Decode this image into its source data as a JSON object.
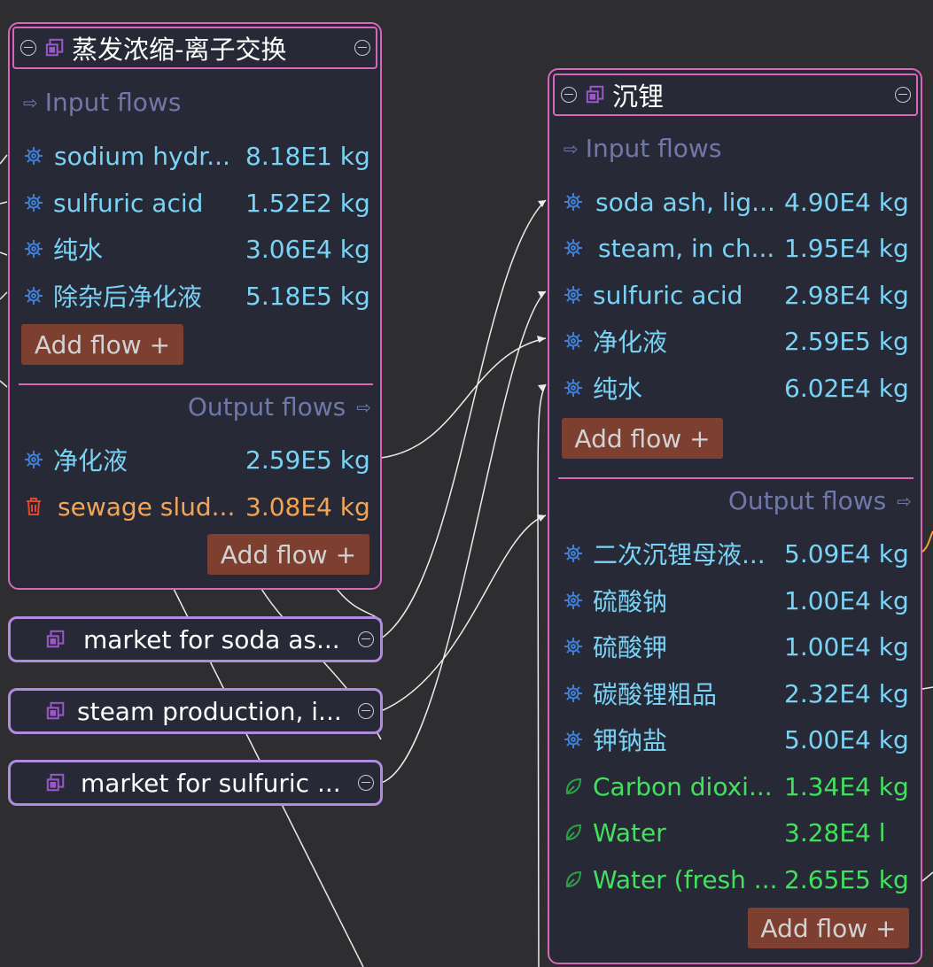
{
  "graph": {
    "colors": {
      "node_border": "#d667b9",
      "provider_border": "#b08be0",
      "technosphere_flow": "#7ad3f5",
      "waste_flow": "#f2a457",
      "elementary_flow": "#43e05f",
      "add_flow_bg": "#7d3f2f",
      "section_label": "#6f78a9"
    },
    "node1": {
      "title": "蒸发浓缩-离子交换",
      "input_label": "Input flows",
      "inputs": [
        {
          "name": "sodium hydr...",
          "amount": "8.18E1 kg",
          "icon": "gear-icon"
        },
        {
          "name": "sulfuric acid",
          "amount": "1.52E2 kg",
          "icon": "gear-icon"
        },
        {
          "name": "纯水",
          "amount": "3.06E4 kg",
          "icon": "gear-icon"
        },
        {
          "name": "除杂后净化液",
          "amount": "5.18E5 kg",
          "icon": "gear-icon"
        }
      ],
      "add_input_label": "Add flow +",
      "output_label": "Output flows",
      "outputs": [
        {
          "name": "净化液",
          "amount": "2.59E5 kg",
          "icon": "gear-icon"
        },
        {
          "name": "sewage slud...",
          "amount": "3.08E4 kg",
          "icon": "trash-icon"
        }
      ],
      "add_output_label": "Add flow +"
    },
    "node2": {
      "title": "沉锂",
      "input_label": "Input flows",
      "inputs": [
        {
          "name": "soda ash, lig...",
          "amount": "4.90E4 kg",
          "icon": "gear-icon"
        },
        {
          "name": "steam, in ch...",
          "amount": "1.95E4 kg",
          "icon": "gear-icon"
        },
        {
          "name": "sulfuric acid",
          "amount": "2.98E4 kg",
          "icon": "gear-icon"
        },
        {
          "name": "净化液",
          "amount": "2.59E5 kg",
          "icon": "gear-icon"
        },
        {
          "name": "纯水",
          "amount": "6.02E4 kg",
          "icon": "gear-icon"
        }
      ],
      "add_input_label": "Add flow +",
      "output_label": "Output flows",
      "outputs": [
        {
          "name": "二次沉锂母液...",
          "amount": "5.09E4 kg",
          "icon": "gear-icon"
        },
        {
          "name": "硫酸钠",
          "amount": "1.00E4 kg",
          "icon": "gear-icon"
        },
        {
          "name": "硫酸钾",
          "amount": "1.00E4 kg",
          "icon": "gear-icon"
        },
        {
          "name": "碳酸锂粗品",
          "amount": "2.32E4 kg",
          "icon": "gear-icon"
        },
        {
          "name": "钾钠盐",
          "amount": "5.00E4 kg",
          "icon": "gear-icon"
        },
        {
          "name": "Carbon dioxi...",
          "amount": "1.34E4 kg",
          "icon": "leaf-icon"
        },
        {
          "name": "Water",
          "amount": "3.28E4 l",
          "icon": "leaf-icon"
        },
        {
          "name": "Water (fresh ...",
          "amount": "2.65E5 kg",
          "icon": "leaf-icon"
        }
      ],
      "add_output_label": "Add flow +"
    },
    "providers": [
      {
        "label": "market for soda as..."
      },
      {
        "label": "steam production, i..."
      },
      {
        "label": "market for sulfuric ..."
      }
    ]
  }
}
